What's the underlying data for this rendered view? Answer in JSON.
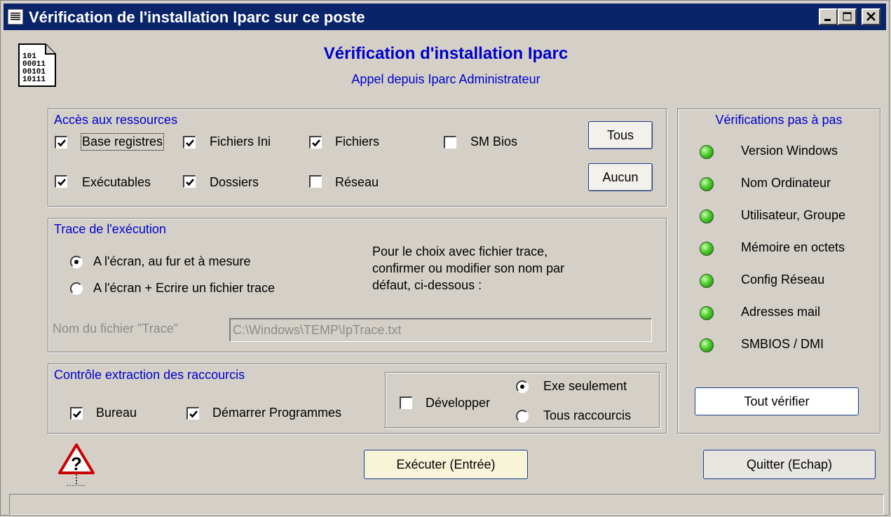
{
  "window": {
    "title": "Vérification de l'installation Iparc sur ce poste"
  },
  "header": {
    "title": "Vérification d'installation Iparc",
    "subtitle": "Appel depuis Iparc Administrateur"
  },
  "resources": {
    "title": "Accès aux ressources",
    "items": [
      {
        "label": "Base registres",
        "checked": true
      },
      {
        "label": "Fichiers Ini",
        "checked": true
      },
      {
        "label": "Fichiers",
        "checked": true
      },
      {
        "label": "SM Bios",
        "checked": false
      },
      {
        "label": "Exécutables",
        "checked": true
      },
      {
        "label": "Dossiers",
        "checked": true
      },
      {
        "label": "Réseau",
        "checked": false
      }
    ],
    "all_button": "Tous",
    "none_button": "Aucun"
  },
  "trace": {
    "title": "Trace de l'exécution",
    "options": [
      {
        "label": "A l'écran, au fur et à mesure",
        "selected": true
      },
      {
        "label": "A l'écran + Ecrire un fichier  trace",
        "selected": false
      }
    ],
    "info_line1": "Pour le choix avec fichier trace,",
    "info_line2": "confirmer ou modifier son nom par",
    "info_line3": "défaut, ci-dessous :",
    "file_label": "Nom du fichier \"Trace\"",
    "file_value": "C:\\Windows\\TEMP\\IpTrace.txt"
  },
  "shortcuts": {
    "title": "Contrôle extraction des raccourcis",
    "desktop": {
      "label": "Bureau",
      "checked": true
    },
    "start_menu": {
      "label": "Démarrer Programmes",
      "checked": true
    },
    "develop": {
      "label": "Développer",
      "checked": false
    },
    "exe_only": {
      "label": "Exe seulement",
      "selected": true
    },
    "all_shortcuts": {
      "label": "Tous raccourcis",
      "selected": false
    }
  },
  "steps": {
    "title": "Vérifications pas à pas",
    "items": [
      {
        "label": "Version Windows",
        "status_color": "#3cc020"
      },
      {
        "label": "Nom Ordinateur",
        "status_color": "#3cc020"
      },
      {
        "label": "Utilisateur, Groupe",
        "status_color": "#3cc020"
      },
      {
        "label": "Mémoire en octets",
        "status_color": "#3cc020"
      },
      {
        "label": "Config Réseau",
        "status_color": "#3cc020"
      },
      {
        "label": "Adresses mail",
        "status_color": "#3cc020"
      },
      {
        "label": "SMBIOS / DMI",
        "status_color": "#3cc020"
      }
    ],
    "check_all_button": "Tout vérifier"
  },
  "footer": {
    "execute_button": "Exécuter (Entrée)",
    "quit_button": "Quitter (Echap)",
    "status_text": ""
  },
  "icons": {
    "app": "binary-file-icon",
    "help": "warning-question-icon"
  },
  "colors": {
    "titlebar": "#0a246a",
    "accent_text": "#0000cc",
    "face": "#d4d0c8"
  }
}
